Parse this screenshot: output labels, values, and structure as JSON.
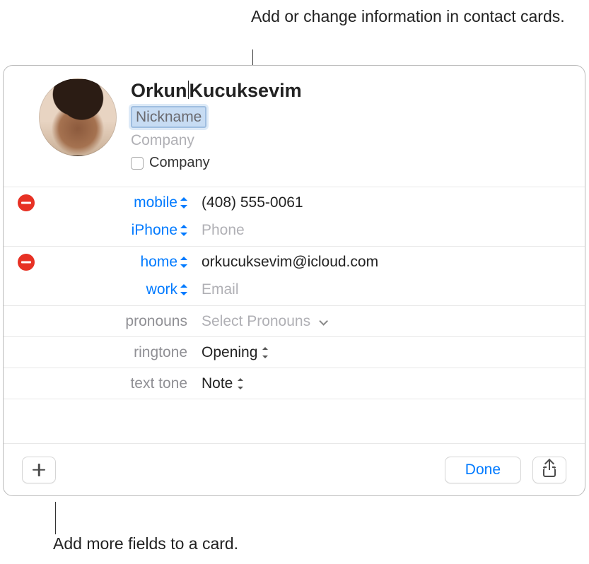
{
  "callouts": {
    "top": "Add or change information in contact cards.",
    "bottom": "Add more fields to a card."
  },
  "contact": {
    "first_name": "Orkun",
    "last_name": "Kucuksevim",
    "nickname_placeholder": "Nickname",
    "company_placeholder": "Company",
    "company_checkbox_label": "Company",
    "company_checked": false
  },
  "phone": {
    "label1": "mobile",
    "value1": "(408) 555-0061",
    "label2": "iPhone",
    "placeholder2": "Phone"
  },
  "email": {
    "label1": "home",
    "value1": "orkucuksevim@icloud.com",
    "label2": "work",
    "placeholder2": "Email"
  },
  "pronouns": {
    "label": "pronouns",
    "value": "Select Pronouns"
  },
  "ringtone": {
    "label": "ringtone",
    "value": "Opening"
  },
  "texttone": {
    "label": "text tone",
    "value": "Note"
  },
  "toolbar": {
    "done": "Done"
  }
}
